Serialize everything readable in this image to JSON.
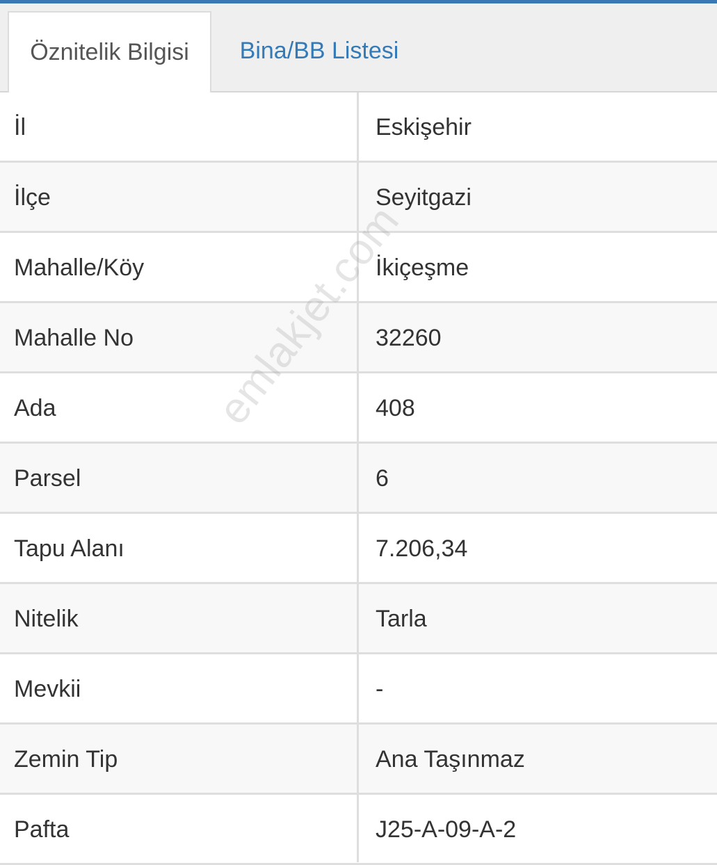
{
  "tabs": [
    {
      "label": "Öznitelik Bilgisi",
      "active": true
    },
    {
      "label": "Bina/BB Listesi",
      "active": false
    }
  ],
  "attributes": [
    {
      "label": "İl",
      "value": "Eskişehir"
    },
    {
      "label": "İlçe",
      "value": "Seyitgazi"
    },
    {
      "label": "Mahalle/Köy",
      "value": "İkiçeşme"
    },
    {
      "label": "Mahalle No",
      "value": "32260"
    },
    {
      "label": "Ada",
      "value": "408"
    },
    {
      "label": "Parsel",
      "value": "6"
    },
    {
      "label": "Tapu Alanı",
      "value": "7.206,34"
    },
    {
      "label": "Nitelik",
      "value": "Tarla"
    },
    {
      "label": "Mevkii",
      "value": "-"
    },
    {
      "label": "Zemin Tip",
      "value": "Ana Taşınmaz"
    },
    {
      "label": "Pafta",
      "value": "J25-A-09-A-2"
    }
  ],
  "watermark": "emlakjet.com",
  "colors": {
    "accent": "#3a78b3",
    "link": "#337ab7",
    "text": "#333333",
    "row_alt": "#f8f8f8",
    "border": "#dedede"
  }
}
